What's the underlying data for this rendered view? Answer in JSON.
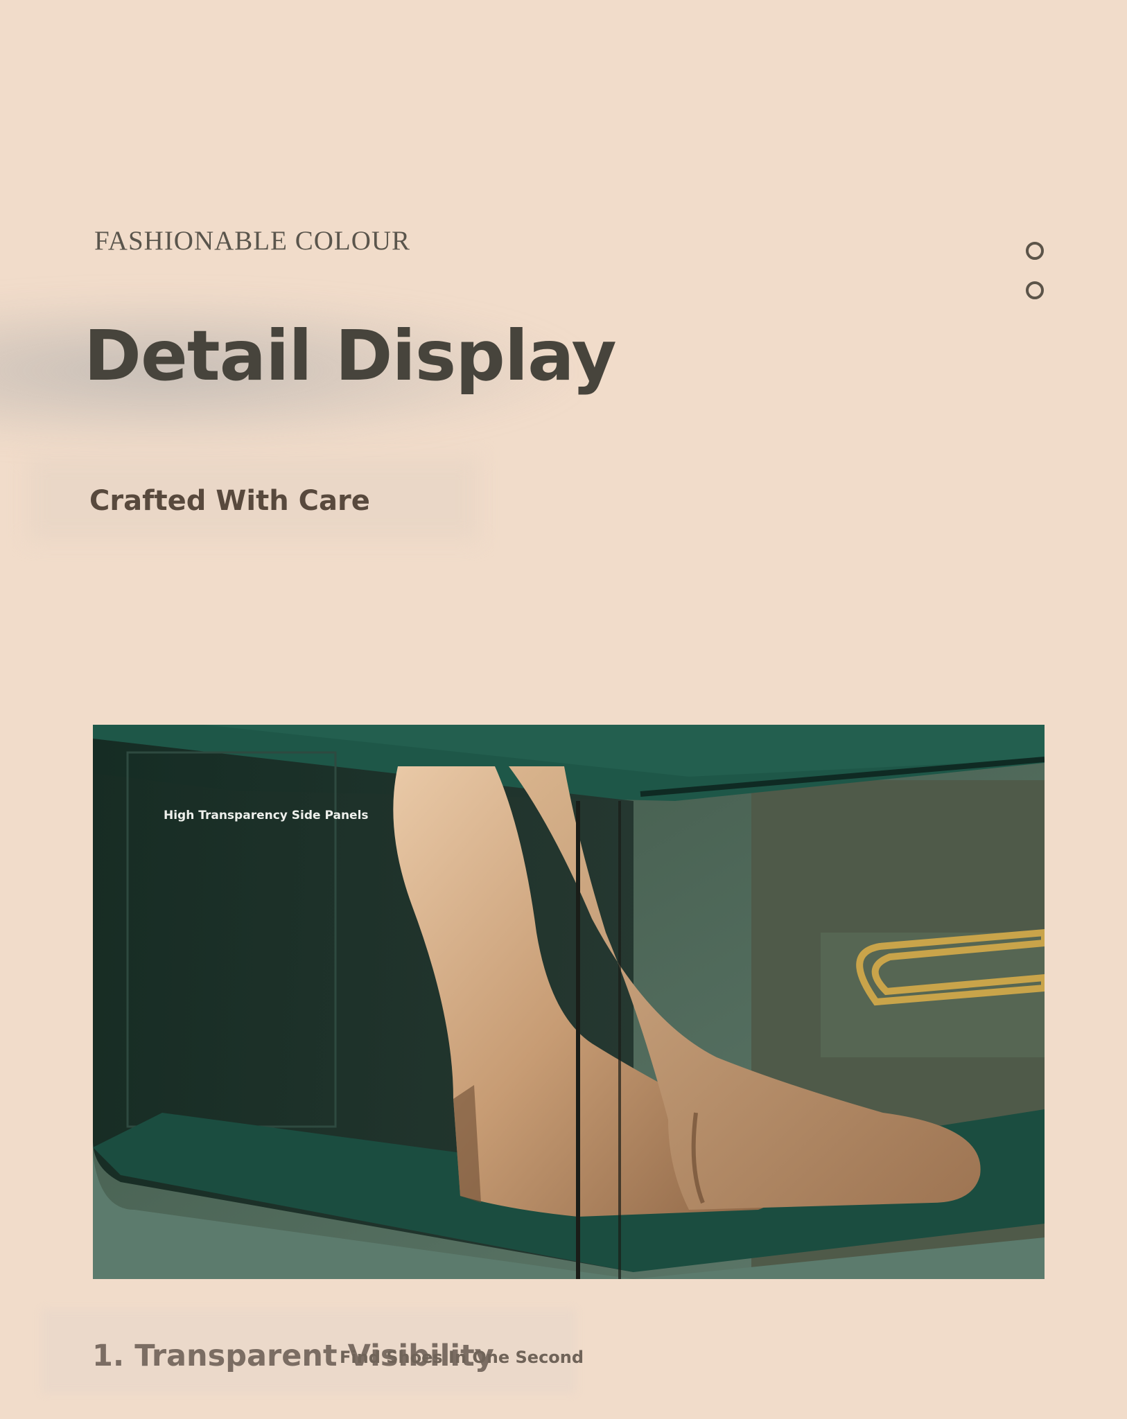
{
  "header": {
    "overline": "FASHIONABLE COLOUR",
    "title": "Detail Display",
    "subtitle": "Crafted With Care"
  },
  "indicators": [
    "ring-icon",
    "ring-icon"
  ],
  "image": {
    "subject": "shoe-box-with-heels",
    "label": "High Transparency Side Panels"
  },
  "feature": {
    "title": "1. Transparent Visibility",
    "subtitle": "Find Shoes In One Second"
  },
  "colors": {
    "background": "#f1dcca",
    "heading": "#47443c",
    "box_green": "#1f5a4a",
    "shoe": "#c9a17a"
  }
}
